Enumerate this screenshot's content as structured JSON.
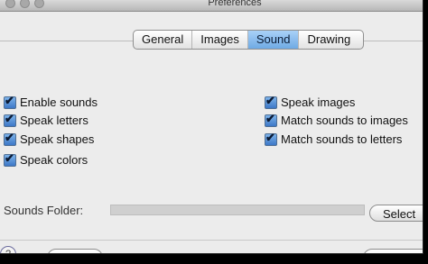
{
  "window": {
    "title": "Preferences"
  },
  "tabs": [
    {
      "label": "General",
      "selected": false
    },
    {
      "label": "Images",
      "selected": false
    },
    {
      "label": "Sound",
      "selected": true
    },
    {
      "label": "Drawing",
      "selected": false
    }
  ],
  "checkboxes_left": [
    {
      "label": "Enable sounds",
      "checked": true
    },
    {
      "label": "Speak letters",
      "checked": true
    },
    {
      "label": "Speak shapes",
      "checked": true
    },
    {
      "label": "Speak colors",
      "checked": true
    }
  ],
  "checkboxes_right": [
    {
      "label": "Speak images",
      "checked": true
    },
    {
      "label": "Match sounds to images",
      "checked": true
    },
    {
      "label": "Match sounds to letters",
      "checked": true
    }
  ],
  "sounds_folder": {
    "label": "Sounds Folder:",
    "value": "",
    "button_label": "Select"
  },
  "colors": {
    "accent": "#6faae4",
    "window_bg": "#ececec"
  }
}
